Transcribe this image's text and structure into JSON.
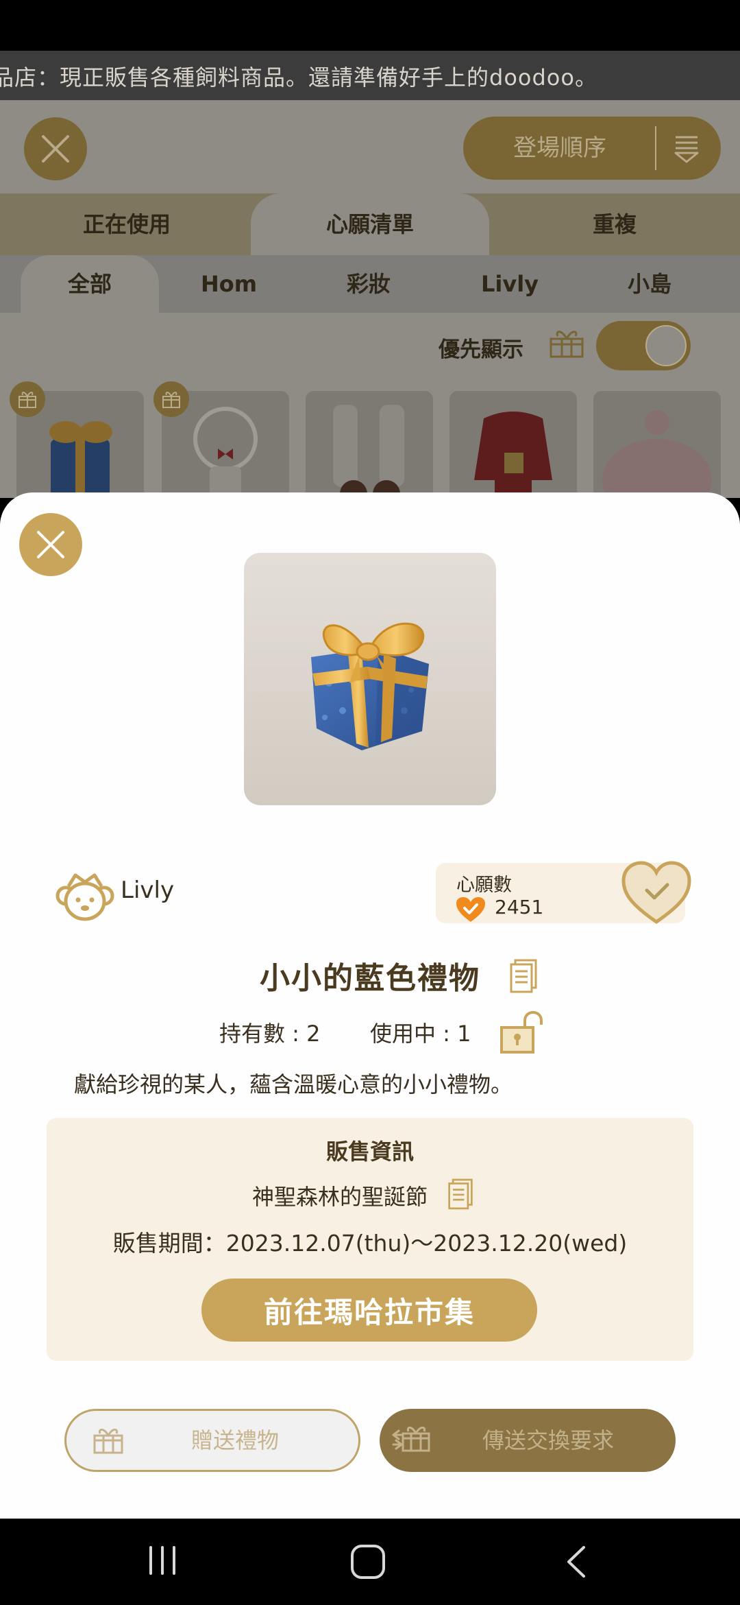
{
  "ticker": {
    "text": "品店：現正販售各種飼料商品。還請準備好手上的doodoo。"
  },
  "background": {
    "sort_label": "登場順序",
    "tabs": [
      "正在使用",
      "心願清單",
      "重複"
    ],
    "active_tab": "心願清單",
    "categories": [
      "全部",
      "Hom",
      "彩妝",
      "Livly",
      "小島"
    ],
    "active_category": "全部",
    "priority_label": "優先顯示",
    "toggle_on": true
  },
  "item": {
    "brand": "Livly",
    "wish": {
      "title": "心願數",
      "count": "2451"
    },
    "name": "小小的藍色禮物",
    "owned": "持有數 : 2",
    "in_use": "使用中 : 1",
    "description": "獻給珍視的某人，蘊含溫暖心意的小小禮物。"
  },
  "sale": {
    "title": "販售資訊",
    "event": "神聖森林的聖誕節",
    "period": "販售期間：2023.12.07(thu)〜2023.12.20(wed)",
    "market_button": "前往瑪哈拉市集"
  },
  "actions": {
    "gift": "贈送禮物",
    "trade": "傳送交換要求"
  },
  "colors": {
    "accent": "#c8a55a",
    "accent_dark": "#8c7343",
    "panel": "#f8f0e2",
    "text": "#3a2f1e"
  }
}
